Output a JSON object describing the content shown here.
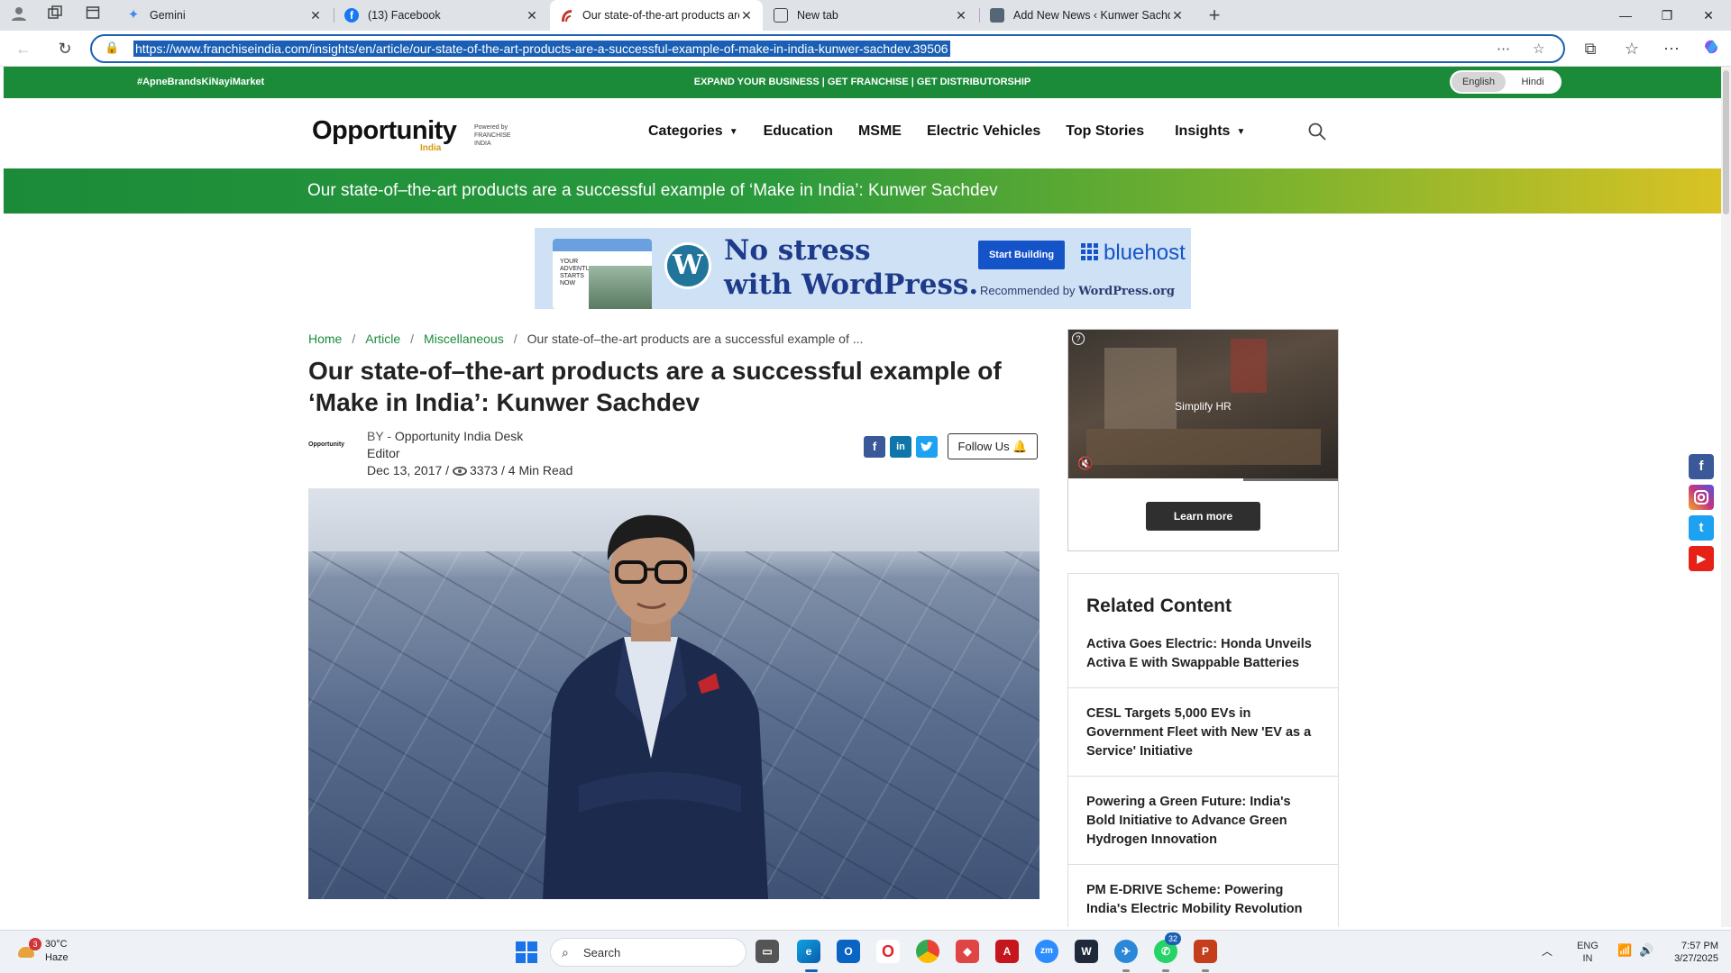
{
  "browser": {
    "tabs": [
      {
        "label": "Gemini",
        "color": "#4285f4"
      },
      {
        "label": "(13) Facebook",
        "color": "#1877f2"
      },
      {
        "label": "Our state-of-the-art products are",
        "color": "#c0392b"
      },
      {
        "label": "New tab",
        "color": "#555555"
      },
      {
        "label": "Add New News ‹ Kunwer Sachdev",
        "color": "#556677"
      }
    ],
    "url": "https://www.franchiseindia.com/insights/en/article/our-state-of-the-art-products-are-a-successful-example-of-make-in-india-kunwer-sachdev.39506"
  },
  "site": {
    "hashtag": "#ApneBrandsKiNayiMarket",
    "promo": "EXPAND YOUR BUSINESS | GET FRANCHISE | GET DISTRIBUTORSHIP",
    "languages": [
      "English",
      "Hindi"
    ],
    "logo": {
      "brand": "Opportunity",
      "sub": "India",
      "powered": "Powered by FRANCHISE INDIA"
    },
    "nav": [
      "Categories",
      "Education",
      "MSME",
      "Electric Vehicles",
      "Top Stories",
      "Insights"
    ],
    "title_band": "Our state-of–the-art products are a successful example of ‘Make in India’: Kunwer Sachdev"
  },
  "ad_banner": {
    "headline_1": "No stress",
    "headline_2": "with WordPress.",
    "cta": "Start Building",
    "brand": "bluehost",
    "recommended_prefix": "Recommended by",
    "recommended_site": "WordPress.org",
    "mock_text": "YOUR ADVENTURE STARTS NOW"
  },
  "article": {
    "breadcrumb": [
      "Home",
      "Article",
      "Miscellaneous"
    ],
    "breadcrumb_current": "Our state-of–the-art products are a successful example of ...",
    "headline": "Our state-of–the-art products are a successful example of ‘Make in India’: Kunwer Sachdev",
    "byline_prefix": "BY - ",
    "author": "Opportunity India Desk",
    "role": "Editor",
    "date": "Dec 13, 2017 /",
    "views": "3373",
    "read_time": "/ 4 Min Read",
    "follow_label": "Follow Us"
  },
  "video_ad": {
    "title": "Simplify HR",
    "cta": "Learn more",
    "progress": 0.65
  },
  "related": {
    "title": "Related Content",
    "items": [
      "Activa Goes Electric: Honda Unveils Activa E with Swappable Batteries",
      "CESL Targets 5,000 EVs in Government Fleet with New 'EV as a Service' Initiative",
      "Powering a Green Future: India's Bold Initiative to Advance Green Hydrogen Innovation",
      "PM E-DRIVE Scheme: Powering India's Electric Mobility Revolution"
    ]
  },
  "colors": {
    "brand_green": "#1b8b3a",
    "facebook": "#3b5998",
    "linkedin": "#0e76a8",
    "twitter": "#1da1f2",
    "instagram": "#c13584",
    "youtube": "#e62117"
  },
  "taskbar": {
    "weather_temp": "30°C",
    "weather_desc": "Haze",
    "weather_badge": "3",
    "search_placeholder": "Search",
    "whatsapp_badge": "32",
    "lang_line1": "ENG",
    "lang_line2": "IN",
    "time": "7:57 PM",
    "date": "3/27/2025"
  }
}
